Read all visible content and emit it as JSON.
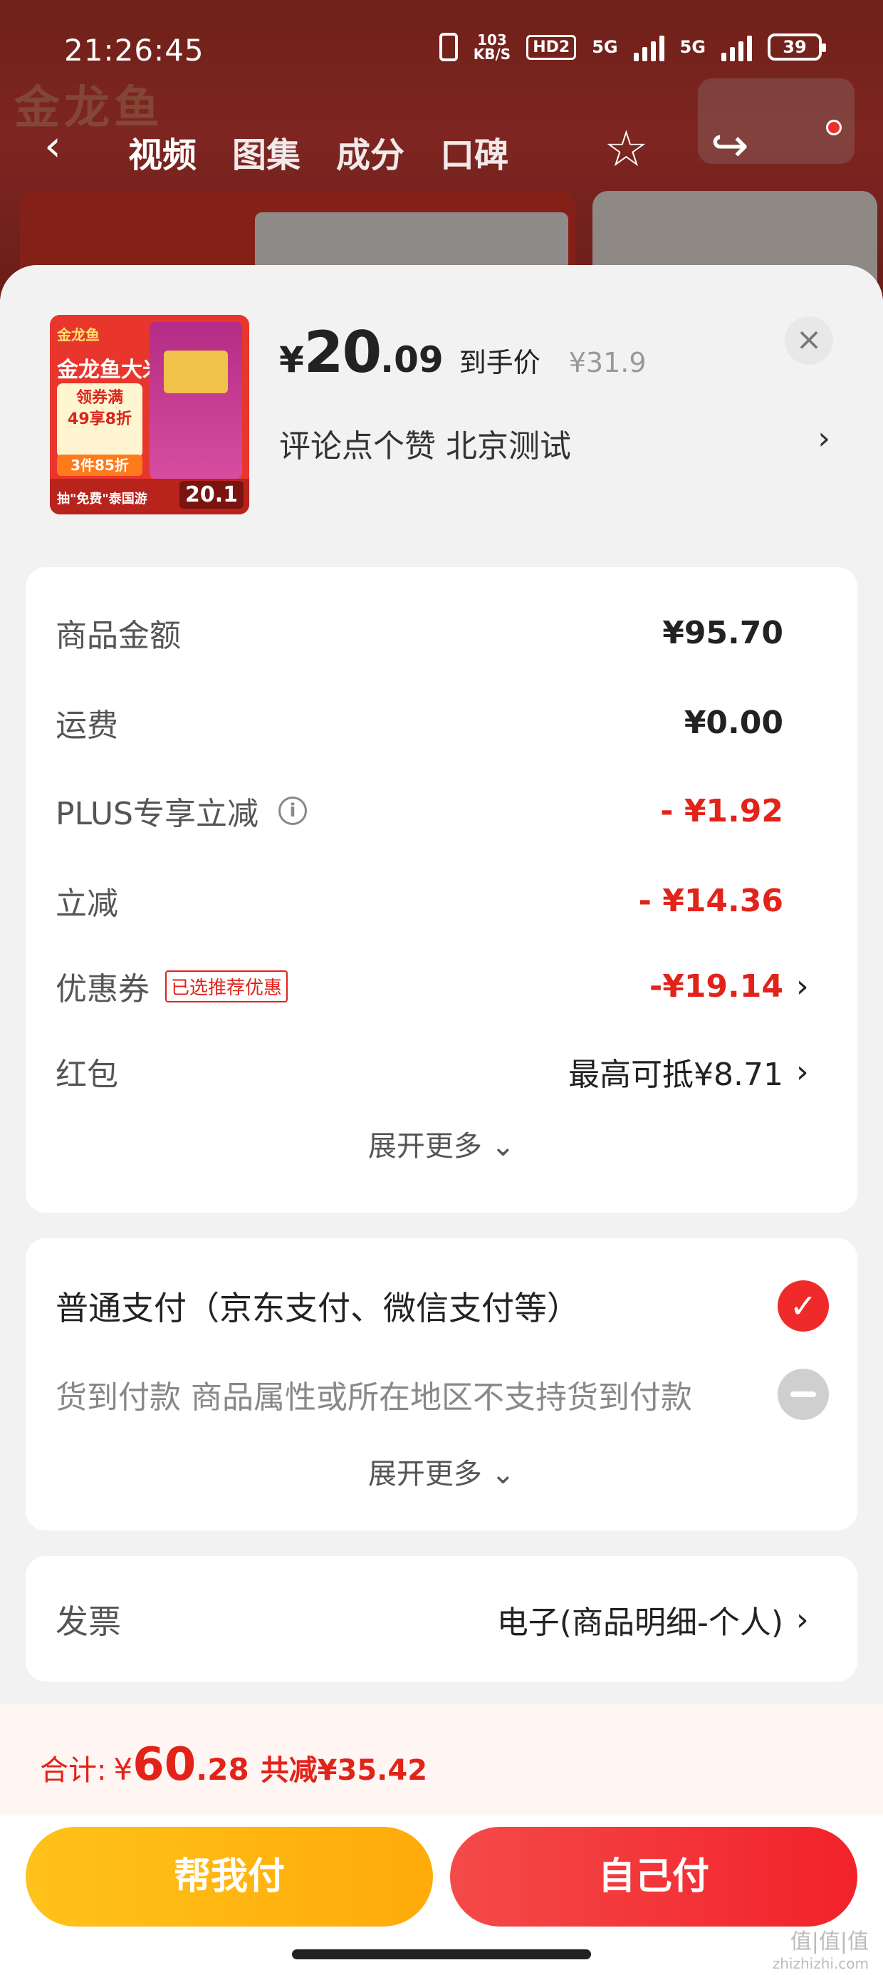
{
  "status_bar": {
    "time": "21:26:45",
    "net_speed_value": "103",
    "net_speed_unit": "KB/S",
    "hd": "HD2",
    "signal1": "5G",
    "signal2": "5G",
    "battery": "39"
  },
  "background_page": {
    "tabs": [
      "视频",
      "图集",
      "成分",
      "口碑"
    ],
    "wordmark": "金龙鱼"
  },
  "product": {
    "thumb": {
      "brand": "金龙鱼",
      "name": "金龙鱼大米",
      "promo_line1": "领券满",
      "promo_line2": "49享8折",
      "promo_line3": "3件85折",
      "footer_text": "抽\"免费\"泰国游",
      "price_badge": "20.1"
    },
    "price_currency": "¥",
    "price_int": "20",
    "price_dec": ".09",
    "price_tag": "到手价",
    "original_price": "¥31.9",
    "spec_text": "评论点个赞  北京测试"
  },
  "amounts": {
    "rows": [
      {
        "label": "商品金额",
        "value": "¥95.70"
      },
      {
        "label": "运费",
        "value": "¥0.00"
      },
      {
        "label": "PLUS专享立减",
        "value": "- ¥1.92"
      },
      {
        "label": "立减",
        "value": "- ¥14.36"
      },
      {
        "label": "优惠券",
        "tag": "已选推荐优惠",
        "value": "-¥19.14"
      },
      {
        "label": "红包",
        "value": "最高可抵¥8.71"
      }
    ],
    "expand_label": "展开更多"
  },
  "payment": {
    "options": [
      {
        "label": "普通支付（京东支付、微信支付等）",
        "selected": true
      },
      {
        "label": "货到付款  商品属性或所在地区不支持货到付款",
        "selected": false
      }
    ],
    "expand_label": "展开更多"
  },
  "invoice": {
    "label": "发票",
    "value": "电子(商品明细-个人)"
  },
  "footer": {
    "total_label": "合计:",
    "total_currency": "¥",
    "total_int": "60",
    "total_dec": ".28",
    "total_save": "共减¥35.42",
    "help_pay_label": "帮我付",
    "self_pay_label": "自己付"
  },
  "watermark": {
    "mark": "值|值|值",
    "site": "zhizhizhi.com"
  },
  "colors": {
    "accent_red": "#e2231a",
    "help_pay_yellow": "#ffb812",
    "self_pay_red": "#f2302e"
  }
}
